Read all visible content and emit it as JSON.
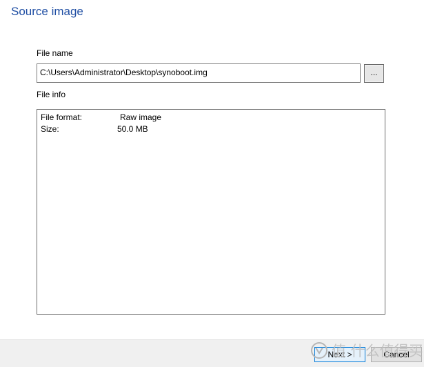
{
  "page": {
    "title": "Source image"
  },
  "file": {
    "name_label": "File name",
    "path_value": "C:\\Users\\Administrator\\Desktop\\synoboot.img",
    "browse_label": "..."
  },
  "info": {
    "label": "File info",
    "format_label": "File format:",
    "format_value": "Raw image",
    "size_label": "Size:",
    "size_value": "50.0 MB"
  },
  "footer": {
    "next_label": "Next >",
    "cancel_label": "Cancel"
  },
  "watermark": {
    "text": "值 什么值得买",
    "color": "#b0b0b0"
  }
}
